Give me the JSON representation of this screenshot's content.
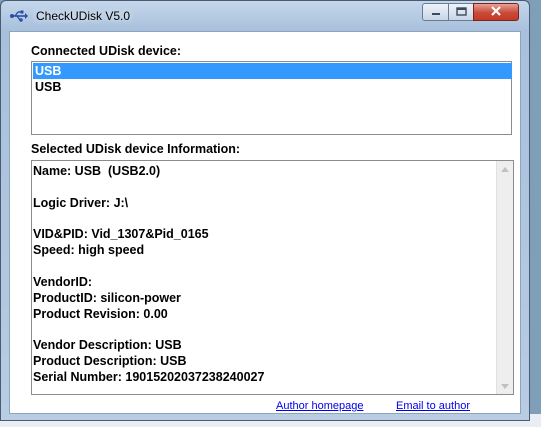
{
  "window": {
    "title": "CheckUDisk V5.0"
  },
  "devices": {
    "label": "Connected UDisk device:",
    "items": [
      "USB",
      "USB"
    ],
    "selected_index": 0
  },
  "info": {
    "label": "Selected UDisk device Information:",
    "lines": [
      "Name: USB  (USB2.0)",
      "",
      "Logic Driver: J:\\",
      "",
      "VID&PID: Vid_1307&Pid_0165",
      "Speed: high speed",
      "",
      "VendorID:",
      "ProductID: silicon-power",
      "Product Revision: 0.00",
      "",
      "Vendor Description: USB",
      "Product Description: USB",
      "Serial Number: 19015202037238240027"
    ]
  },
  "links": {
    "homepage": "Author homepage",
    "email": "Email to author"
  },
  "colors": {
    "selection": "#3399ff",
    "link": "#0000ee",
    "close_button": "#c94a38"
  },
  "icons": {
    "app": "usb-icon",
    "minimize": "minimize-icon",
    "maximize": "maximize-icon",
    "close": "close-icon"
  }
}
